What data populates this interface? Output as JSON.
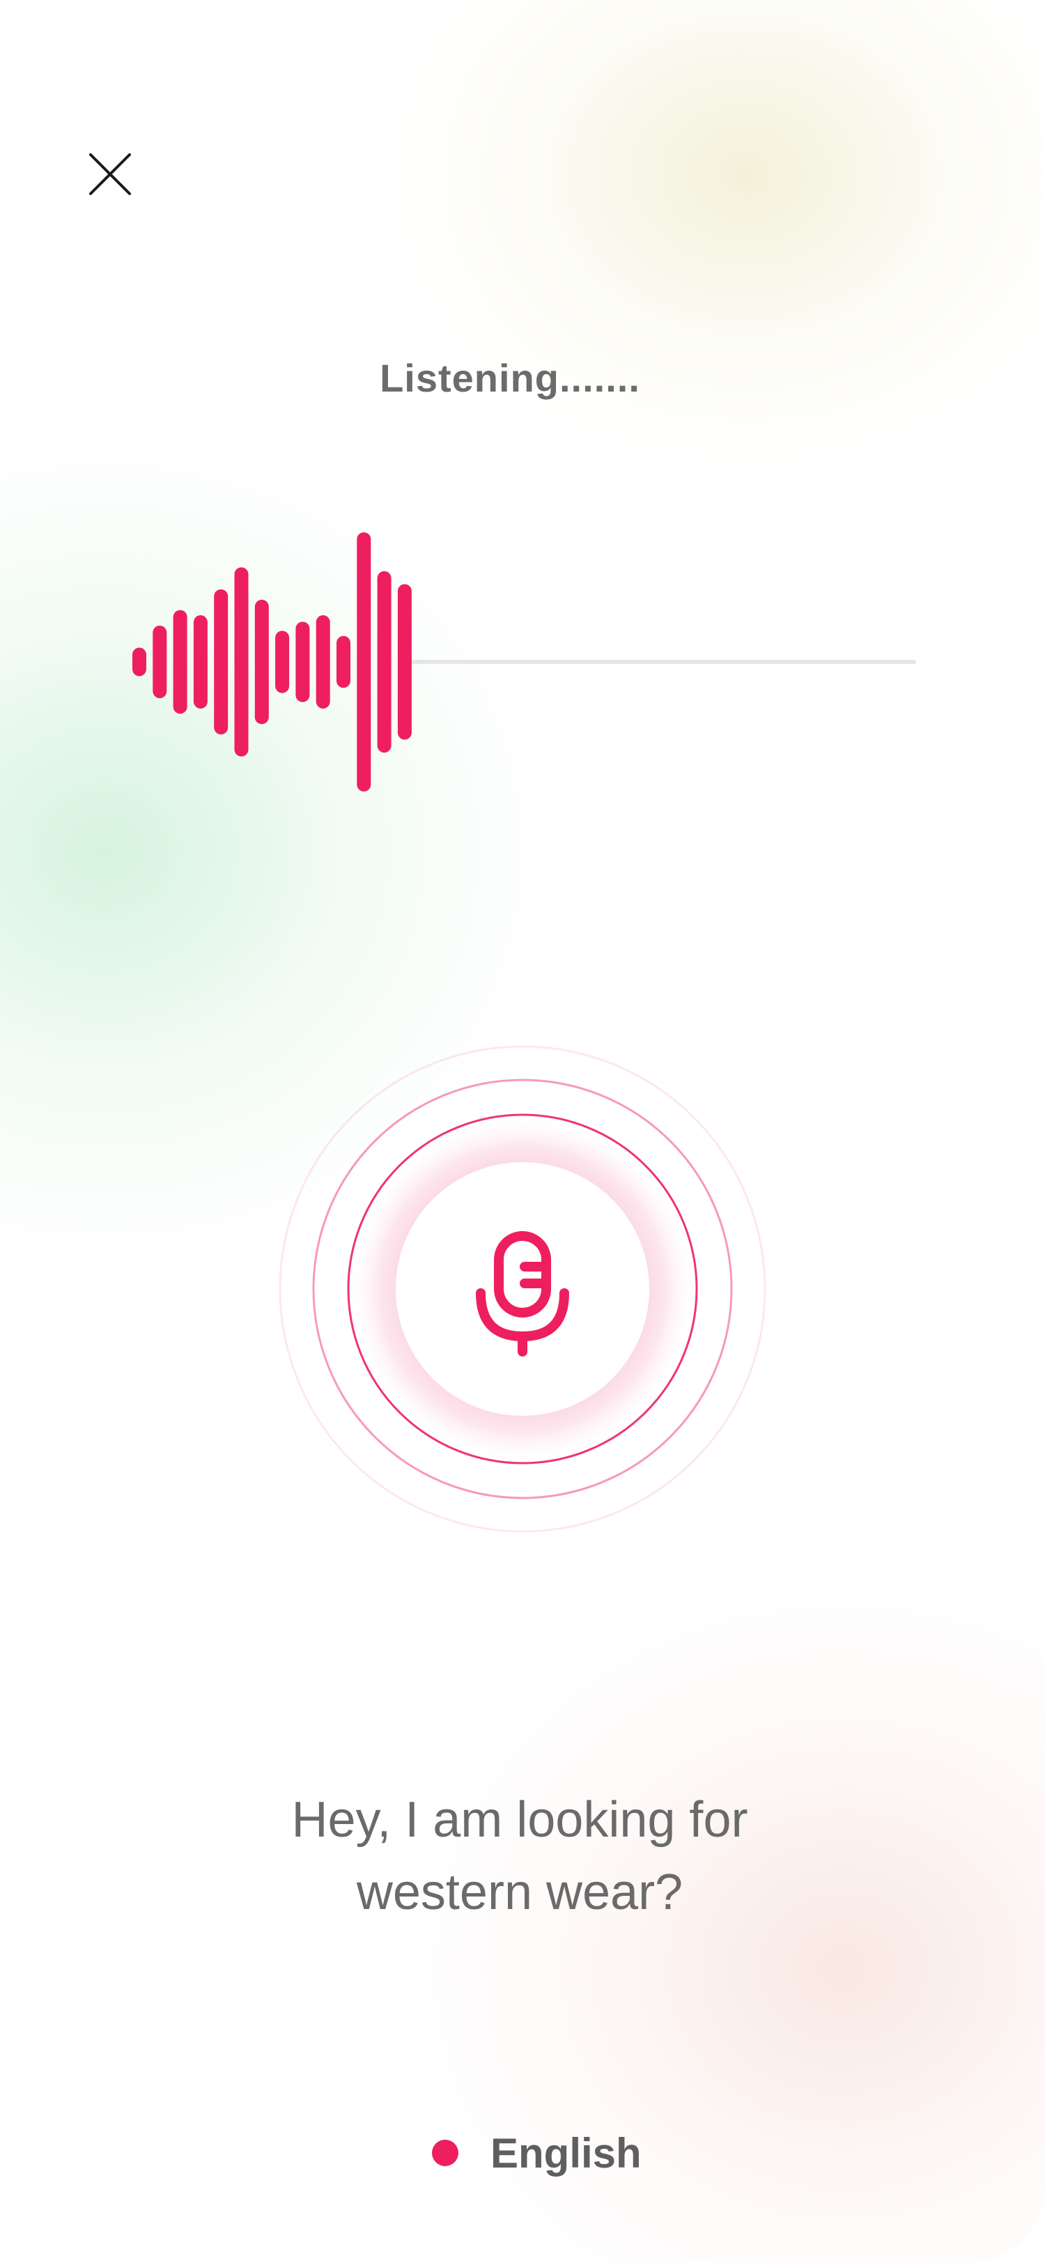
{
  "theme": {
    "accent": "#EE1F5E",
    "text_muted": "#6B6B6B"
  },
  "close_button": {
    "icon": "close-icon"
  },
  "status": {
    "label": "Listening......."
  },
  "waveform": {
    "levels": [
      0.11,
      0.28,
      0.4,
      0.36,
      0.56,
      0.73,
      0.48,
      0.24,
      0.31,
      0.36,
      0.2,
      1.0,
      0.7,
      0.6
    ],
    "color": "#EE1F5E",
    "track_color": "#E6E6E6"
  },
  "mic_button": {
    "icon": "microphone-icon"
  },
  "transcript": {
    "line1": "Hey, I am looking for",
    "line2": "western wear?"
  },
  "language": {
    "label": "English",
    "indicator_color": "#EE1F5E"
  }
}
